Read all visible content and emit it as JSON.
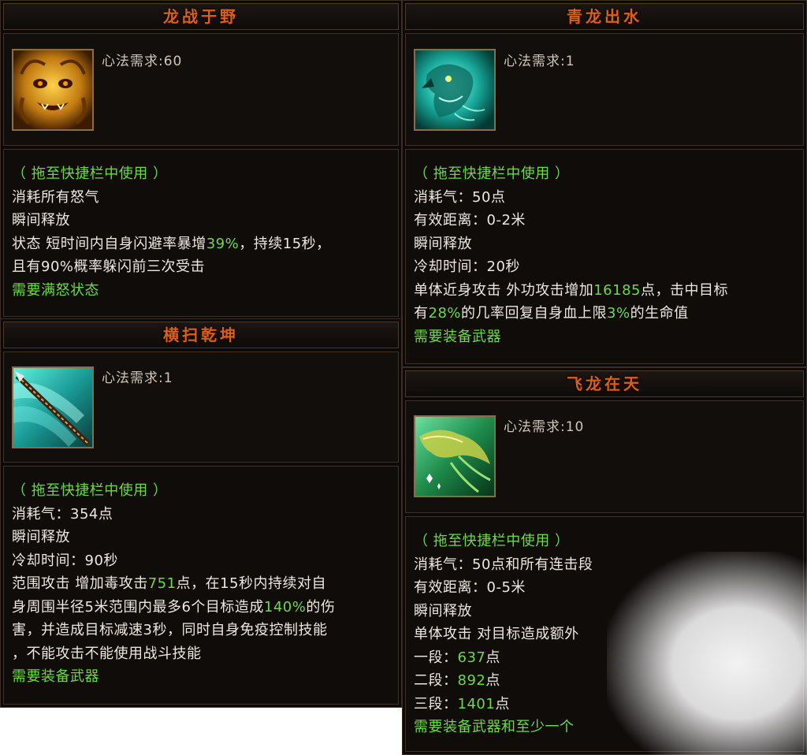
{
  "skills": [
    {
      "id": "longzhanyuye",
      "title": "龙战于野",
      "requirement": "心法需求:60",
      "icon": "golden-dragon-face-icon",
      "drag_hint": "（ 拖至快捷栏中使用 ）",
      "lines": [
        [
          "消耗所有怒气"
        ],
        [
          "瞬间释放"
        ],
        [
          "状态  短时间内自身闪避率暴增",
          {
            "num": "39%"
          },
          "，持续15秒，"
        ],
        [
          "且有90%概率躲闪前三次受击"
        ]
      ],
      "need": "需要满怒状态"
    },
    {
      "id": "hengsaoqiankun",
      "title": "横扫乾坤",
      "requirement": "心法需求:1",
      "icon": "spear-slash-icon",
      "drag_hint": "（ 拖至快捷栏中使用 ）",
      "lines": [
        [
          "消耗气：354点"
        ],
        [
          "瞬间释放"
        ],
        [
          "冷却时间：90秒"
        ],
        [
          "范围攻击  增加毒攻击",
          {
            "num": "751"
          },
          "点，在15秒内持续对自"
        ],
        [
          "身周围半径5米范围内最多6个目标造成",
          {
            "num": "140%"
          },
          "的伤"
        ],
        [
          "害，并造成目标减速3秒，同时自身免疫控制技能"
        ],
        [
          "，不能攻击不能使用战斗技能"
        ]
      ],
      "need": "需要装备武器"
    },
    {
      "id": "qinglongchushui",
      "title": "青龙出水",
      "requirement": "心法需求:1",
      "icon": "azure-dragon-head-icon",
      "drag_hint": "（ 拖至快捷栏中使用 ）",
      "lines": [
        [
          "消耗气：50点"
        ],
        [
          "有效距离：0-2米"
        ],
        [
          "瞬间释放"
        ],
        [
          "冷却时间：20秒"
        ],
        [
          "单体近身攻击  外功攻击增加",
          {
            "num": "16185"
          },
          "点，击中目标"
        ],
        [
          "有",
          {
            "num": "28%"
          },
          "的几率回复自身血上限",
          {
            "num": "3%"
          },
          "的生命值"
        ]
      ],
      "need": "需要装备武器"
    },
    {
      "id": "feilongzaitian",
      "title": "飞龙在天",
      "requirement": "心法需求:10",
      "icon": "flying-green-dragon-icon",
      "drag_hint": "（ 拖至快捷栏中使用 ）",
      "lines": [
        [
          "消耗气：50点和所有连击段"
        ],
        [
          "有效距离：0-5米"
        ],
        [
          "瞬间释放"
        ],
        [
          "单体攻击  对目标造成额外"
        ],
        [
          "一段：",
          {
            "num": "637"
          },
          "点"
        ],
        [
          "二段：",
          {
            "num": "892"
          },
          "点"
        ],
        [
          "三段：",
          {
            "num": "1401"
          },
          "点"
        ]
      ],
      "need": "需要装备武器和至少一个"
    }
  ],
  "colors": {
    "title": "#d9601c",
    "highlight": "#6fd84a",
    "text": "#ece7e0",
    "panel_bg": "#0c0908"
  }
}
